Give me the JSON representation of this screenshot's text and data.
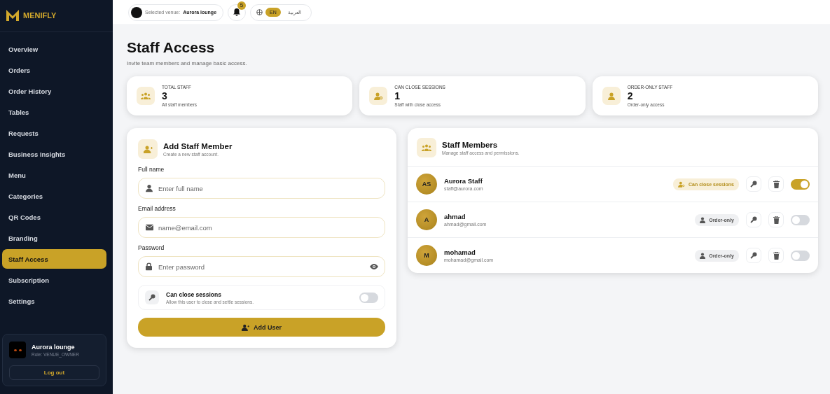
{
  "brand": "MENIFLY",
  "sidebar": {
    "items": [
      {
        "label": "Overview",
        "selected": false
      },
      {
        "label": "Orders",
        "selected": false
      },
      {
        "label": "Order History",
        "selected": false
      },
      {
        "label": "Tables",
        "selected": false
      },
      {
        "label": "Requests",
        "selected": false
      },
      {
        "label": "Business Insights",
        "selected": false
      },
      {
        "label": "Menu",
        "selected": false
      },
      {
        "label": "Categories",
        "selected": false
      },
      {
        "label": "QR Codes",
        "selected": false
      },
      {
        "label": "Branding",
        "selected": false
      },
      {
        "label": "Staff Access",
        "selected": true
      },
      {
        "label": "Subscription",
        "selected": false
      },
      {
        "label": "Settings",
        "selected": false
      }
    ],
    "venue": {
      "name": "Aurora lounge",
      "role": "Role: VENUE_OWNER",
      "logout": "Log out"
    }
  },
  "topbar": {
    "venue_label": "Selected venue:",
    "venue": "Aurora lounge",
    "notifications": "5",
    "languages": [
      {
        "label": "EN",
        "selected": true
      },
      {
        "label": "العربية",
        "selected": false
      }
    ]
  },
  "page": {
    "title": "Staff Access",
    "subtitle": "Invite team members and manage basic access."
  },
  "stats": [
    {
      "kind": "group",
      "label": "TOTAL STAFF",
      "value": "3",
      "caption": "All staff members"
    },
    {
      "kind": "key",
      "label": "CAN CLOSE SESSIONS",
      "value": "1",
      "caption": "Staff with close access"
    },
    {
      "kind": "person",
      "label": "ORDER-ONLY STAFF",
      "value": "2",
      "caption": "Order-only access"
    }
  ],
  "add_form": {
    "title": "Add Staff Member",
    "subtitle": "Create a new staff account.",
    "fields": [
      {
        "kind": "person",
        "label": "Full name",
        "placeholder": "Enter full name"
      },
      {
        "kind": "mail",
        "label": "Email address",
        "placeholder": "name@email.com"
      },
      {
        "kind": "lock",
        "label": "Password",
        "placeholder": "Enter password"
      }
    ],
    "permission": {
      "title": "Can close sessions",
      "description": "Allow this user to close and settle sessions.",
      "on": false
    },
    "submit": "Add User"
  },
  "members": {
    "title": "Staff Members",
    "subtitle": "Manage staff access and permissions.",
    "rows": [
      {
        "initials": "AS",
        "name": "Aurora Staff",
        "email": "staff@aurora.com",
        "role": {
          "kind": "close",
          "label": "Can close sessions"
        },
        "on": true
      },
      {
        "initials": "A",
        "name": "ahmad",
        "email": "ahmad@gmail.com",
        "role": {
          "kind": "order",
          "label": "Order-only"
        },
        "on": false
      },
      {
        "initials": "M",
        "name": "mohamad",
        "email": "mohamad@gmail.com",
        "role": {
          "kind": "order",
          "label": "Order-only"
        },
        "on": false
      }
    ]
  }
}
